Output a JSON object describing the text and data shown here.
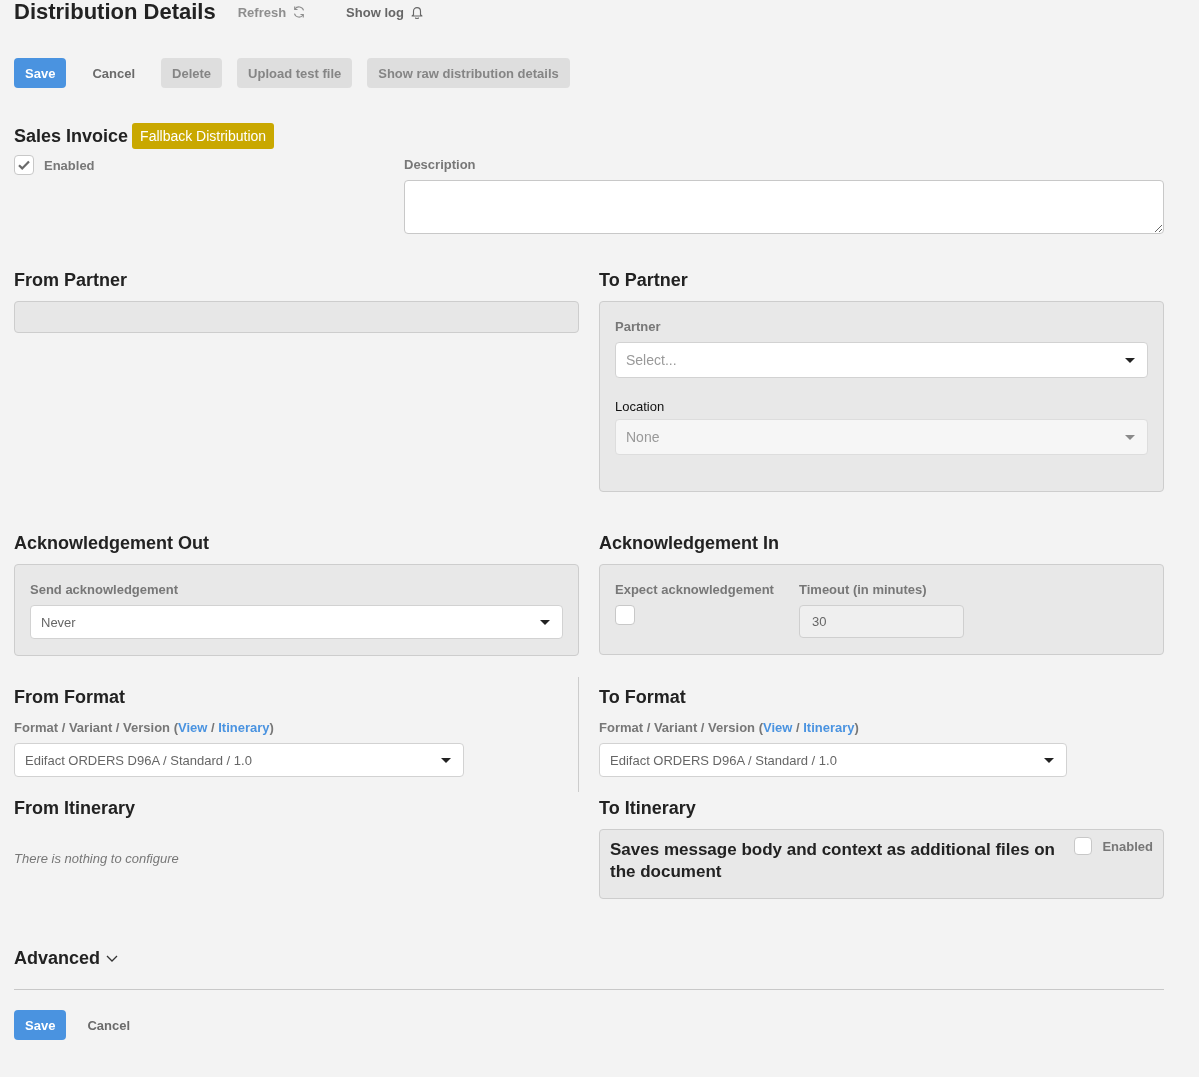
{
  "header": {
    "title": "Distribution Details",
    "actions": [
      {
        "label": "Refresh",
        "kind": "refresh",
        "disabled": true
      },
      {
        "label": "Show log",
        "kind": "bell",
        "disabled": false
      }
    ]
  },
  "toolbar": [
    {
      "label": "Save",
      "kind": "primary",
      "disabled": false
    },
    {
      "label": "Cancel",
      "kind": "link",
      "disabled": false
    },
    {
      "label": "Delete",
      "kind": "default",
      "disabled": true
    },
    {
      "label": "Upload test file",
      "kind": "default",
      "disabled": true
    },
    {
      "label": "Show raw distribution details",
      "kind": "default",
      "disabled": true
    }
  ],
  "document": {
    "title": "Sales Invoice",
    "badge": "Fallback Distribution",
    "enabled": {
      "label": "Enabled",
      "checked": true
    },
    "description": {
      "label": "Description"
    }
  },
  "from_partner": {
    "title": "From Partner",
    "field": {
      "disabled": true
    }
  },
  "to_partner": {
    "title": "To Partner",
    "fields": [
      {
        "label": "Partner",
        "placeholder": "Select...",
        "disabled": false
      },
      {
        "label": "Location",
        "placeholder": "None",
        "disabled": true
      }
    ]
  },
  "acknowledgement_out": {
    "title": "Acknowledgement Out",
    "field": {
      "label": "Send acknowledgement",
      "value": "Never"
    }
  },
  "acknowledgement_in": {
    "title": "Acknowledgement In",
    "expect": {
      "label": "Expect acknowledgement",
      "checked": false
    },
    "timeout": {
      "label": "Timeout (in minutes)",
      "value": "30",
      "disabled": true
    }
  },
  "from_format": {
    "title": "From Format",
    "label": [
      {
        "text": "Format / Variant / Version (",
        "kind": "text"
      },
      {
        "text": "View",
        "kind": "link"
      },
      {
        "text": " / ",
        "kind": "text"
      },
      {
        "text": "Itinerary",
        "kind": "link"
      },
      {
        "text": ")",
        "kind": "text"
      }
    ],
    "value": "Edifact ORDERS D96A / Standard / 1.0"
  },
  "to_format": {
    "title": "To Format",
    "label": [
      {
        "text": "Format / Variant / Version (",
        "kind": "text"
      },
      {
        "text": "View",
        "kind": "link"
      },
      {
        "text": " / ",
        "kind": "text"
      },
      {
        "text": "Itinerary",
        "kind": "link"
      },
      {
        "text": ")",
        "kind": "text"
      }
    ],
    "value": "Edifact ORDERS D96A / Standard / 1.0"
  },
  "from_itinerary": {
    "title": "From Itinerary",
    "message": "There is nothing to configure"
  },
  "to_itinerary": {
    "title": "To Itinerary",
    "steps": [
      {
        "description": "Saves message body and context as additional files on the document",
        "enabled": {
          "label": "Enabled",
          "checked": false
        }
      }
    ]
  },
  "advanced": {
    "label": "Advanced",
    "expanded": false
  },
  "footer": [
    {
      "label": "Save",
      "kind": "primary"
    },
    {
      "label": "Cancel",
      "kind": "link"
    }
  ]
}
